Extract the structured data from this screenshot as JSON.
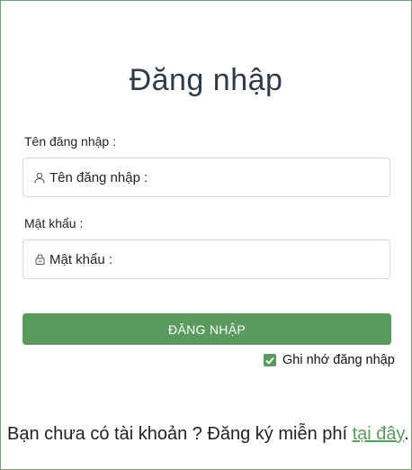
{
  "page_title": "Đăng nhập",
  "username": {
    "label": "Tên đăng nhập :",
    "placeholder": "Tên đăng nhập :",
    "value": ""
  },
  "password": {
    "label": "Mật khẩu :",
    "placeholder": "Mật khẩu :",
    "value": ""
  },
  "login_button_label": "ĐĂNG NHẬP",
  "remember": {
    "label": "Ghi nhớ đăng nhập",
    "checked": true
  },
  "footer": {
    "text_before": "Bạn chưa có tài khoản ? Đăng ký miễn phí ",
    "link_text": "tại đây",
    "text_after": "."
  },
  "colors": {
    "accent": "#5a9a5c",
    "border": "#6aa36e",
    "title": "#2f3b4a"
  },
  "icons": {
    "username": "user-icon",
    "password": "lock-icon",
    "remember": "checkmark-icon"
  }
}
